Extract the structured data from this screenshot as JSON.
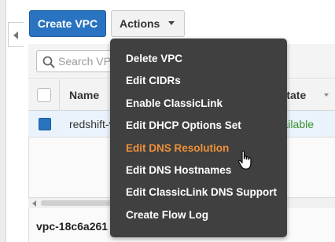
{
  "toolbar": {
    "create_label": "Create VPC",
    "actions_label": "Actions"
  },
  "search": {
    "placeholder": "Search VPCs"
  },
  "table": {
    "columns": [
      "Name",
      "State"
    ],
    "rows": [
      {
        "name": "redshift-vpc",
        "state": "available",
        "selected": true
      }
    ]
  },
  "detail": {
    "title": "vpc-18c6a261"
  },
  "actions_menu": {
    "items": [
      "Delete VPC",
      "Edit CIDRs",
      "Enable ClassicLink",
      "Edit DHCP Options Set",
      "Edit DNS Resolution",
      "Edit DNS Hostnames",
      "Edit ClassicLink DNS Support",
      "Create Flow Log"
    ],
    "hovered_item": "Edit DNS Resolution"
  },
  "colors": {
    "primary_button": "#2a73c0",
    "menu_background": "#404040",
    "menu_hover_text": "#f0913a",
    "state_available": "#3a8f2e",
    "selected_row": "#eaf3fb"
  },
  "icons": {
    "search": "search-icon",
    "dropdown": "chevron-down-icon",
    "collapse": "chevron-left-icon",
    "cursor": "hand-pointer-icon"
  }
}
